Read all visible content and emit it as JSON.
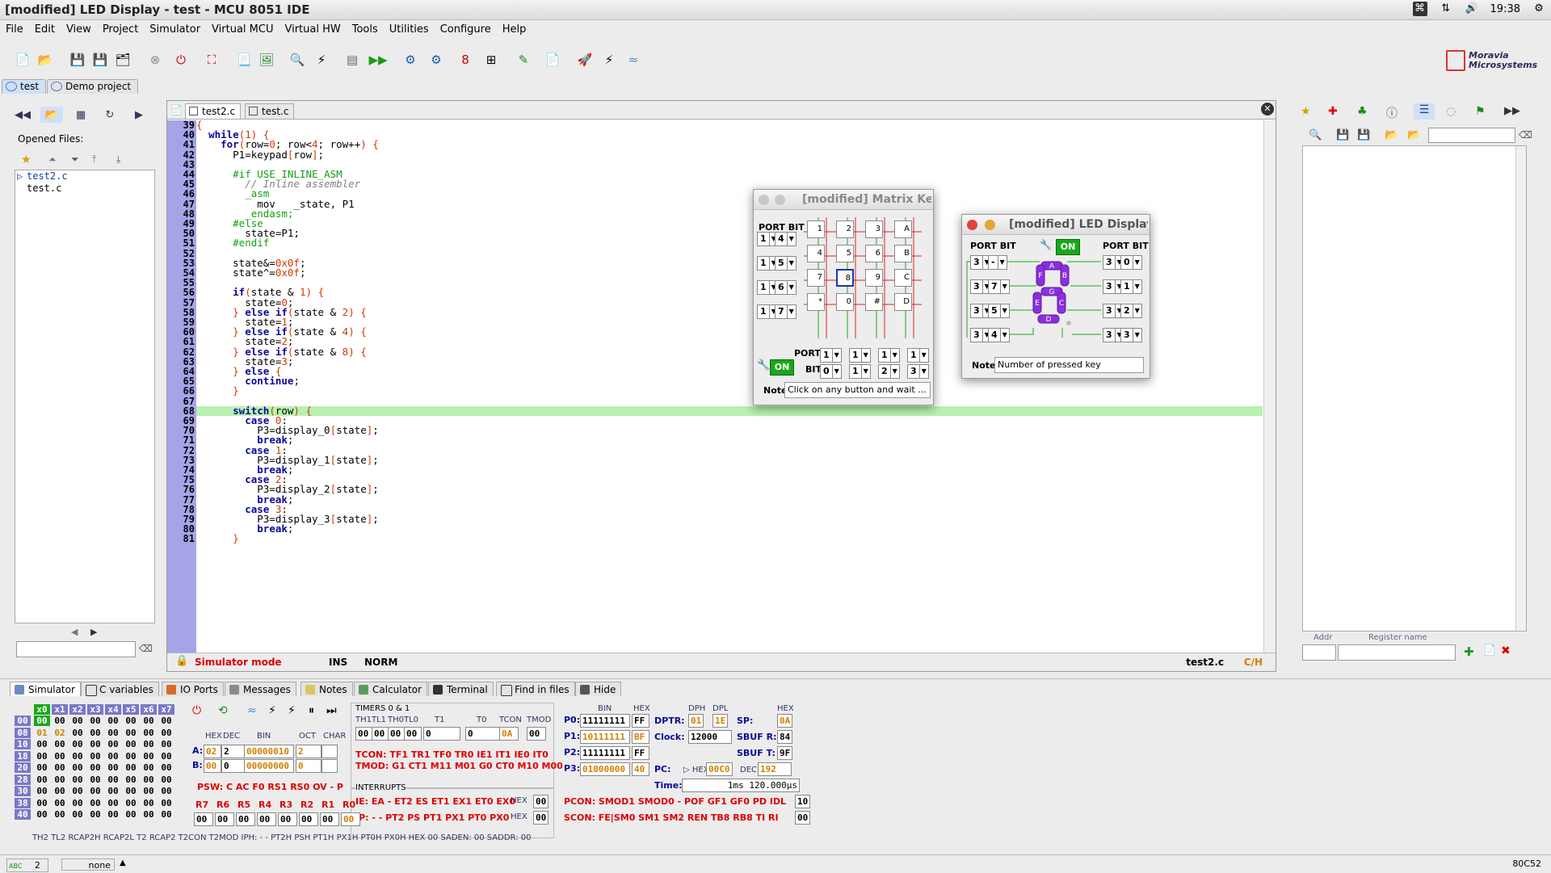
{
  "window_title": "[modified] LED Display - test - MCU 8051 IDE",
  "tray": {
    "time": "19:38"
  },
  "menu": [
    "File",
    "Edit",
    "View",
    "Project",
    "Simulator",
    "Virtual MCU",
    "Virtual HW",
    "Tools",
    "Utilities",
    "Configure",
    "Help"
  ],
  "brand": {
    "line1": "Moravia",
    "line2": "Microsystems"
  },
  "project_tabs": [
    "test",
    "Demo project"
  ],
  "left": {
    "opened_files_label": "Opened Files:",
    "files": [
      "test2.c",
      "test.c"
    ]
  },
  "editor": {
    "tabs": [
      "test2.c",
      "test.c"
    ],
    "status_mode": "Simulator mode",
    "status_ins": "INS",
    "status_norm": "NORM",
    "status_file": "test2.c",
    "status_type": "C/H",
    "lines": [
      {
        "n": "39",
        "t": "{"
      },
      {
        "n": "40",
        "t": "  while(1) {"
      },
      {
        "n": "41",
        "t": "    for(row=0; row<4; row++) {"
      },
      {
        "n": "42",
        "t": "      P1=keypad[row];"
      },
      {
        "n": "43",
        "t": ""
      },
      {
        "n": "44",
        "t": "      #if USE_INLINE_ASM"
      },
      {
        "n": "45",
        "t": "        // Inline assembler"
      },
      {
        "n": "46",
        "t": "        _asm"
      },
      {
        "n": "47",
        "t": "          mov   _state, P1"
      },
      {
        "n": "48",
        "t": "        _endasm;"
      },
      {
        "n": "49",
        "t": "      #else"
      },
      {
        "n": "50",
        "t": "        state=P1;"
      },
      {
        "n": "51",
        "t": "      #endif"
      },
      {
        "n": "52",
        "t": ""
      },
      {
        "n": "53",
        "t": "      state&=0x0f;"
      },
      {
        "n": "54",
        "t": "      state^=0x0f;"
      },
      {
        "n": "55",
        "t": ""
      },
      {
        "n": "56",
        "t": "      if(state & 1) {"
      },
      {
        "n": "57",
        "t": "        state=0;"
      },
      {
        "n": "58",
        "t": "      } else if(state & 2) {"
      },
      {
        "n": "59",
        "t": "        state=1;"
      },
      {
        "n": "60",
        "t": "      } else if(state & 4) {"
      },
      {
        "n": "61",
        "t": "        state=2;"
      },
      {
        "n": "62",
        "t": "      } else if(state & 8) {"
      },
      {
        "n": "63",
        "t": "        state=3;"
      },
      {
        "n": "64",
        "t": "      } else {"
      },
      {
        "n": "65",
        "t": "        continue;"
      },
      {
        "n": "66",
        "t": "      }"
      },
      {
        "n": "67",
        "t": ""
      },
      {
        "n": "68",
        "t": "      switch(row) {"
      },
      {
        "n": "69",
        "t": "        case 0:"
      },
      {
        "n": "70",
        "t": "          P3=display_0[state];"
      },
      {
        "n": "71",
        "t": "          break;"
      },
      {
        "n": "72",
        "t": "        case 1:"
      },
      {
        "n": "73",
        "t": "          P3=display_1[state];"
      },
      {
        "n": "74",
        "t": "          break;"
      },
      {
        "n": "75",
        "t": "        case 2:"
      },
      {
        "n": "76",
        "t": "          P3=display_2[state];"
      },
      {
        "n": "77",
        "t": "          break;"
      },
      {
        "n": "78",
        "t": "        case 3:"
      },
      {
        "n": "79",
        "t": "          P3=display_3[state];"
      },
      {
        "n": "80",
        "t": "          break;"
      },
      {
        "n": "81",
        "t": "      }"
      }
    ]
  },
  "matrix_keypad": {
    "title": "[modified] Matrix Key",
    "port_bit_label": "PORT BIT",
    "row_spins": [
      [
        "1",
        "4"
      ],
      [
        "1",
        "5"
      ],
      [
        "1",
        "6"
      ],
      [
        "1",
        "7"
      ]
    ],
    "keys": [
      "1",
      "2",
      "3",
      "A",
      "4",
      "5",
      "6",
      "B",
      "7",
      "8",
      "9",
      "C",
      "*",
      "0",
      "#",
      "D"
    ],
    "port_label": "PORT",
    "bit_label": "BIT",
    "col_ports": [
      "1",
      "1",
      "1",
      "1"
    ],
    "col_bits": [
      "0",
      "1",
      "2",
      "3"
    ],
    "on_label": "ON",
    "note_label": "Note",
    "note_value": "Click on any button and wait ..."
  },
  "led_display": {
    "title": "[modified] LED Display",
    "port_bit_left": "PORT BIT",
    "port_bit_right": "PORT BIT",
    "on_label": "ON",
    "left_spins": [
      [
        "3",
        "-"
      ],
      [
        "3",
        "7"
      ],
      [
        "3",
        "5"
      ],
      [
        "3",
        "4"
      ]
    ],
    "right_spins": [
      [
        "3",
        "0"
      ],
      [
        "3",
        "1"
      ],
      [
        "3",
        "2"
      ],
      [
        "3",
        "3"
      ]
    ],
    "segments": [
      "A",
      "B",
      "F",
      "G",
      "C",
      "E",
      "D"
    ],
    "note_label": "Note",
    "note_value": "Number of pressed key"
  },
  "right_panel": {
    "addr_label": "Addr",
    "reg_label": "Register name"
  },
  "bottom_tabs": [
    "Simulator",
    "C variables",
    "IO Ports",
    "Messages",
    "Notes",
    "Calculator",
    "Terminal",
    "Find in files",
    "Hide"
  ],
  "sim": {
    "mem_cols": [
      "x0",
      "x1",
      "x2",
      "x3",
      "x4",
      "x5",
      "x6",
      "x7"
    ],
    "mem_rows": [
      {
        "a": "00",
        "v": [
          "00",
          "00",
          "00",
          "00",
          "00",
          "00",
          "00",
          "00"
        ]
      },
      {
        "a": "08",
        "v": [
          "01",
          "02",
          "00",
          "00",
          "00",
          "00",
          "00",
          "00"
        ]
      },
      {
        "a": "10",
        "v": [
          "00",
          "00",
          "00",
          "00",
          "00",
          "00",
          "00",
          "00"
        ]
      },
      {
        "a": "18",
        "v": [
          "00",
          "00",
          "00",
          "00",
          "00",
          "00",
          "00",
          "00"
        ]
      },
      {
        "a": "20",
        "v": [
          "00",
          "00",
          "00",
          "00",
          "00",
          "00",
          "00",
          "00"
        ]
      },
      {
        "a": "28",
        "v": [
          "00",
          "00",
          "00",
          "00",
          "00",
          "00",
          "00",
          "00"
        ]
      },
      {
        "a": "30",
        "v": [
          "00",
          "00",
          "00",
          "00",
          "00",
          "00",
          "00",
          "00"
        ]
      },
      {
        "a": "38",
        "v": [
          "00",
          "00",
          "00",
          "00",
          "00",
          "00",
          "00",
          "00"
        ]
      },
      {
        "a": "40",
        "v": [
          "00",
          "00",
          "00",
          "00",
          "00",
          "00",
          "00",
          "00"
        ]
      }
    ],
    "reg_headers": [
      "HEX",
      "DEC",
      "BIN",
      "OCT",
      "CHAR"
    ],
    "A": {
      "label": "A:",
      "hex": "02",
      "dec": "2",
      "bin": "00000010",
      "oct": "2"
    },
    "B": {
      "label": "B:",
      "hex": "00",
      "dec": "0",
      "bin": "00000000",
      "oct": "0"
    },
    "psw": "PSW: C  AC  F0  RS1  RS0  OV  -  P",
    "r_labels": [
      "R7",
      "R6",
      "R5",
      "R4",
      "R3",
      "R2",
      "R1",
      "R0"
    ],
    "r_values": [
      "00",
      "00",
      "00",
      "00",
      "00",
      "00",
      "00",
      "00"
    ],
    "timers_title": "TIMERS 0 & 1",
    "timer_headers": [
      "TH1",
      "TL1",
      "TH0",
      "TL0",
      "T1",
      "T0",
      "TCON",
      "TMOD"
    ],
    "timer_values": [
      "00",
      "00",
      "00",
      "00",
      "0",
      "0",
      "0A",
      "00"
    ],
    "tcon": "TCON: TF1 TR1 TF0 TR0 IE1 IT1 IE0 IT0",
    "tmod": "TMOD: G1 CT1 M11 M01 G0 CT0 M10 M00",
    "interrupts_title": "INTERRUPTS",
    "ie": "IE: EA - ET2 ES ET1 EX1 ET0 EX0",
    "ip": "IP: - - PT2 PS PT1 PX1 PT0 PX0",
    "ie_hex": "00",
    "ip_hex": "00",
    "ports": [
      {
        "l": "P0:",
        "bin": "11111111",
        "hex": "FF"
      },
      {
        "l": "P1:",
        "bin": "10111111",
        "hex": "BF"
      },
      {
        "l": "P2:",
        "bin": "11111111",
        "hex": "FF"
      },
      {
        "l": "P3:",
        "bin": "01000000",
        "hex": "40"
      }
    ],
    "dptr": {
      "label": "DPTR:",
      "dph": "01",
      "dpl": "1E"
    },
    "clock": {
      "label": "Clock:",
      "value": "12000"
    },
    "sp": {
      "label": "SP:",
      "value": "0A"
    },
    "sbufr": {
      "label": "SBUF R:",
      "value": "84"
    },
    "sbuft": {
      "label": "SBUF T:",
      "value": "9F"
    },
    "pc": {
      "label": "PC:",
      "hex": "00C0",
      "dec": "192"
    },
    "time": {
      "label": "Time:",
      "value": "1ms 120.000μs"
    },
    "pcon": "PCON: SMOD1 SMOD0 - POF GF1 GF0 PD IDL",
    "scon": "SCON: FE|SM0 SM1 SM2 REN TB8 RB8 TI RI",
    "pcon_hex": "10",
    "scon_hex": "00",
    "bottom_row": "TH2 TL2 RCAP2H RCAP2L  T2   RCAP2 T2CON T2MOD   IPH: - - PT2H PSH PT1H PX1H PT0H PX0H HEX 00   SADEN: 00 SADDR: 00"
  },
  "statusbar": {
    "count": "2",
    "none": "none",
    "mcu": "80C52"
  }
}
